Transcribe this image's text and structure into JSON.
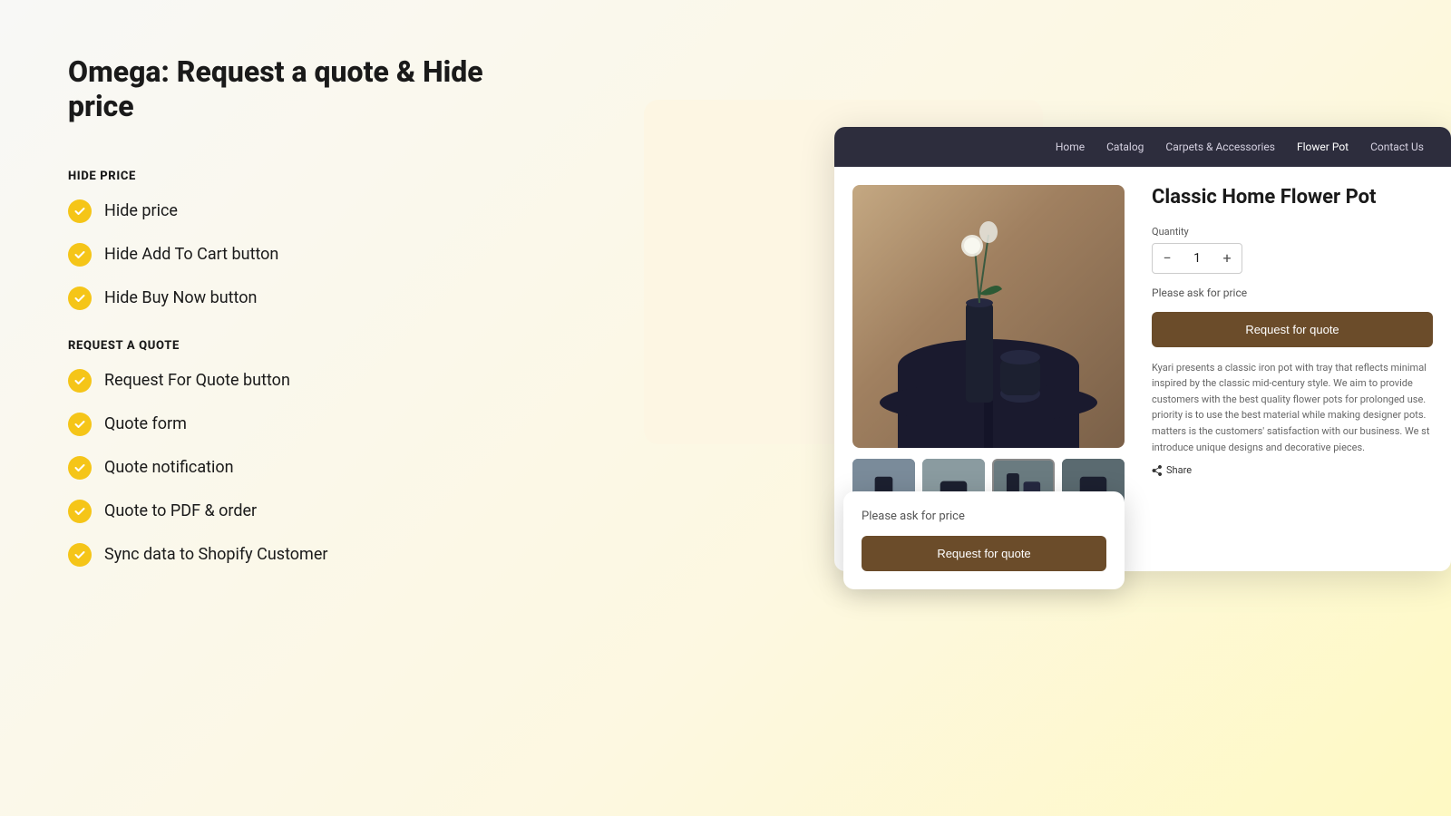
{
  "page": {
    "title": "Omega: Request a quote & Hide price"
  },
  "hide_price_section": {
    "heading": "HIDE PRICE",
    "features": [
      "Hide price",
      "Hide Add To Cart button",
      "Hide Buy Now button"
    ]
  },
  "request_quote_section": {
    "heading": "REQUEST A QUOTE",
    "features": [
      "Request For Quote button",
      "Quote form",
      "Quote notification",
      "Quote to PDF & order",
      "Sync data to Shopify Customer"
    ]
  },
  "store_preview": {
    "nav_items": [
      "Home",
      "Catalog",
      "Carpets & Accessories",
      "Flower Pot",
      "Contact Us"
    ],
    "product_title": "Classic Home Flower Pot",
    "quantity_label": "Quantity",
    "quantity_value": "1",
    "qty_minus": "−",
    "qty_plus": "+",
    "ask_price_text": "Please ask for price",
    "rfq_button": "Request for quote",
    "description": "Kyari presents a classic iron pot with tray that reflects minimal inspired by the classic mid-century style. We aim to provide customers with the best quality flower pots for prolonged use. priority is to use the best material while making designer pots. matters is the customers' satisfaction with our business. We st introduce unique designs and decorative pieces.",
    "share_label": "Share"
  },
  "popup": {
    "ask_price_text": "Please ask for price",
    "rfq_button": "Request for quote"
  },
  "colors": {
    "accent_yellow": "#f5c518",
    "dark_nav": "#2d2d3d",
    "rfq_brown": "#6b4c2a",
    "bg_cream": "#fdf6e3"
  }
}
